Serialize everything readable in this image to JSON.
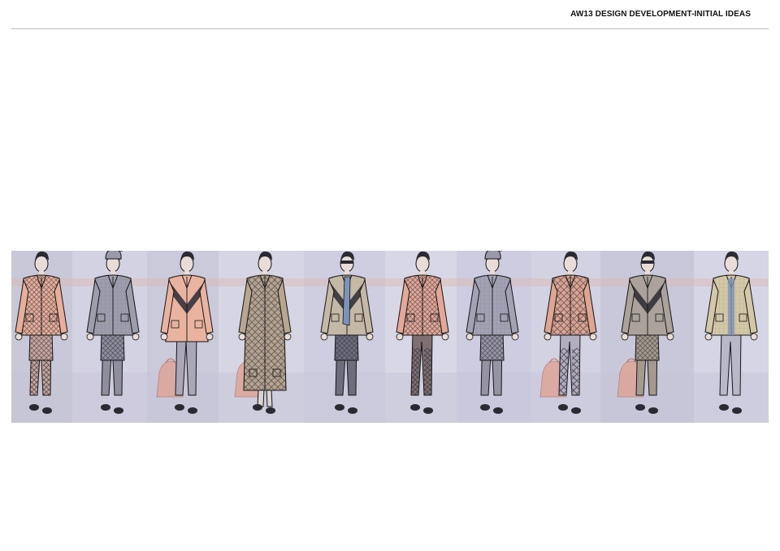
{
  "header": {
    "title": "AW13 DESIGN DEVELOPMENT-INITIAL IDEAS"
  },
  "lineup": {
    "palette": {
      "peach": "#e9b29e",
      "grey": "#8f8e9e",
      "dark": "#2a2a33",
      "ink": "#151515",
      "blue": "#7d93b8",
      "beige": "#cfc2a3",
      "bag": "#e0a08f"
    },
    "looks": [
      {
        "id": 1,
        "jacket": "#e7ae9a",
        "pants": "#c6a49e",
        "pattern": "check",
        "style": "jacket-shorts",
        "hat": false,
        "bag": false
      },
      {
        "id": 2,
        "jacket": "#9d9dac",
        "pants": "#8e8e9c",
        "pattern": "panel",
        "style": "bomber-knickers",
        "hat": true,
        "bag": false
      },
      {
        "id": 3,
        "jacket": "#eab3a0",
        "pants": "#a9a7b8",
        "pattern": "chevron",
        "style": "cardigan-trousers",
        "hat": false,
        "bag": true
      },
      {
        "id": 4,
        "jacket": "#b7a690",
        "pants": "#a69c8c",
        "pattern": "tartan",
        "style": "long-coat",
        "hat": false,
        "bag": true
      },
      {
        "id": 5,
        "jacket": "#c4b8a6",
        "pants": "#6e6d7d",
        "pattern": "chevron",
        "style": "jacket-knickers",
        "hat": false,
        "bag": false
      },
      {
        "id": 6,
        "jacket": "#e3a898",
        "pants": "#7d6f72",
        "pattern": "check",
        "style": "jacket-trousers",
        "hat": false,
        "bag": false
      },
      {
        "id": 7,
        "jacket": "#a3a2b4",
        "pants": "#9694a4",
        "pattern": "panel",
        "style": "coat-shorts",
        "hat": true,
        "bag": false
      },
      {
        "id": 8,
        "jacket": "#dea693",
        "pants": "#b2aebf",
        "pattern": "tartan",
        "style": "vest-trousers",
        "hat": false,
        "bag": true
      },
      {
        "id": 9,
        "jacket": "#aba39b",
        "pants": "#a49a8e",
        "pattern": "chevron",
        "style": "jacket-shorts",
        "hat": false,
        "bag": true
      },
      {
        "id": 10,
        "jacket": "#d4c8a8",
        "pants": "#b9b8c8",
        "pattern": "panel",
        "style": "shirt-trousers",
        "hat": false,
        "bag": false
      }
    ]
  }
}
